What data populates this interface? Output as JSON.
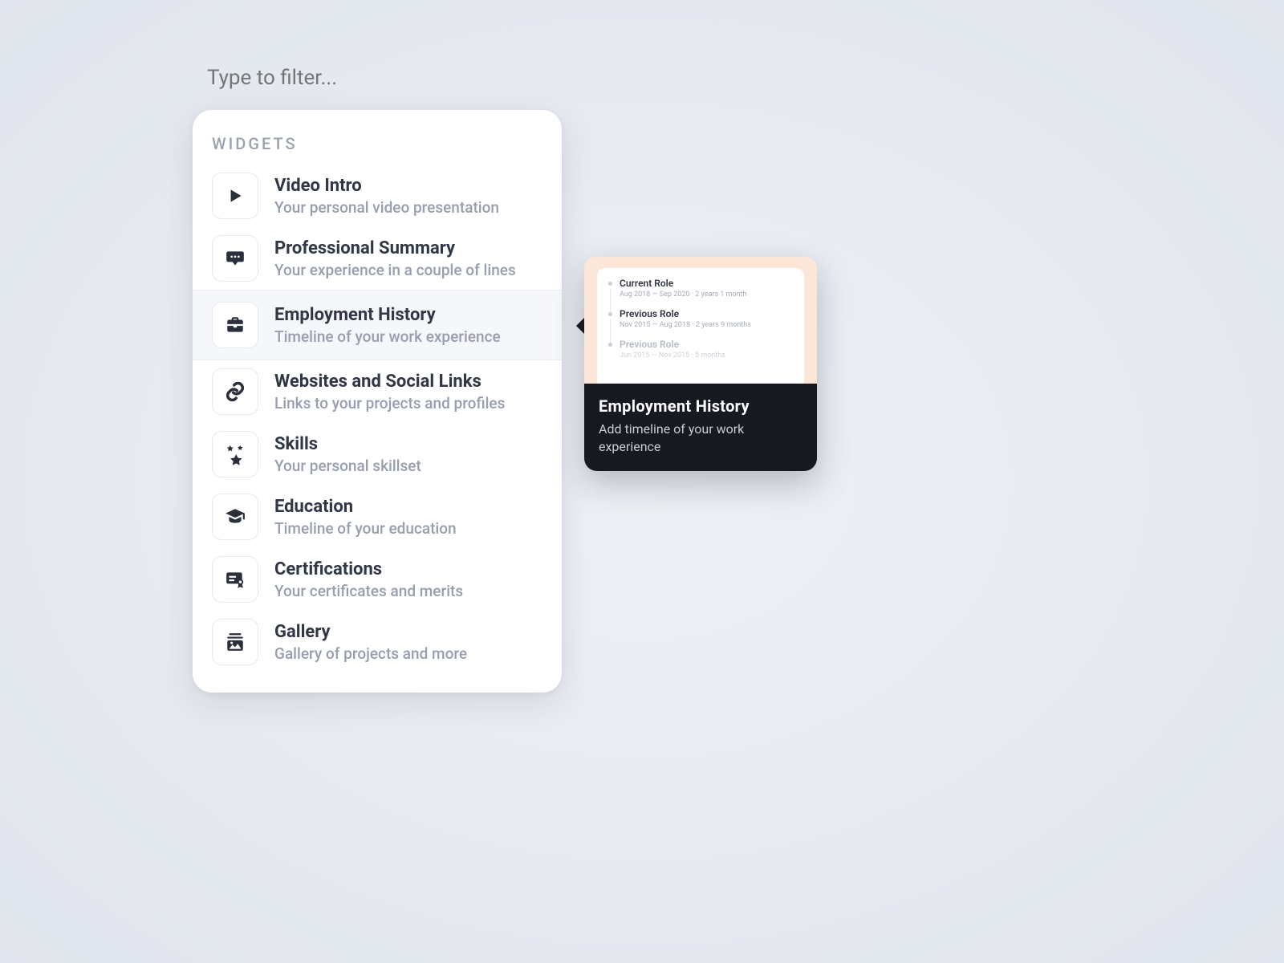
{
  "filter": {
    "placeholder": "Type to filter..."
  },
  "section_label": "WIDGETS",
  "widgets": [
    {
      "icon": "play",
      "title": "Video Intro",
      "desc": "Your personal video presentation"
    },
    {
      "icon": "chat",
      "title": "Professional Summary",
      "desc": "Your experience in a couple of lines"
    },
    {
      "icon": "briefcase",
      "title": "Employment History",
      "desc": "Timeline of your work experience"
    },
    {
      "icon": "link",
      "title": "Websites and Social Links",
      "desc": "Links to your projects and profiles"
    },
    {
      "icon": "stars",
      "title": "Skills",
      "desc": "Your personal skillset"
    },
    {
      "icon": "graduation",
      "title": "Education",
      "desc": "Timeline of your education"
    },
    {
      "icon": "certificate",
      "title": "Certifications",
      "desc": "Your certificates and merits"
    },
    {
      "icon": "gallery",
      "title": "Gallery",
      "desc": "Gallery of projects and more"
    }
  ],
  "selected_index": 2,
  "preview": {
    "title": "Employment History",
    "desc": "Add timeline of your work experience",
    "timeline": [
      {
        "title": "Current Role",
        "meta": "Aug 2018 — Sep 2020 · 2 years 1 month",
        "faded": false
      },
      {
        "title": "Previous Role",
        "meta": "Nov 2015 — Aug 2018 · 2 years 9 months",
        "faded": false
      },
      {
        "title": "Previous Role",
        "meta": "Jun 2015 — Nov 2015 · 5 months",
        "faded": true
      }
    ]
  }
}
